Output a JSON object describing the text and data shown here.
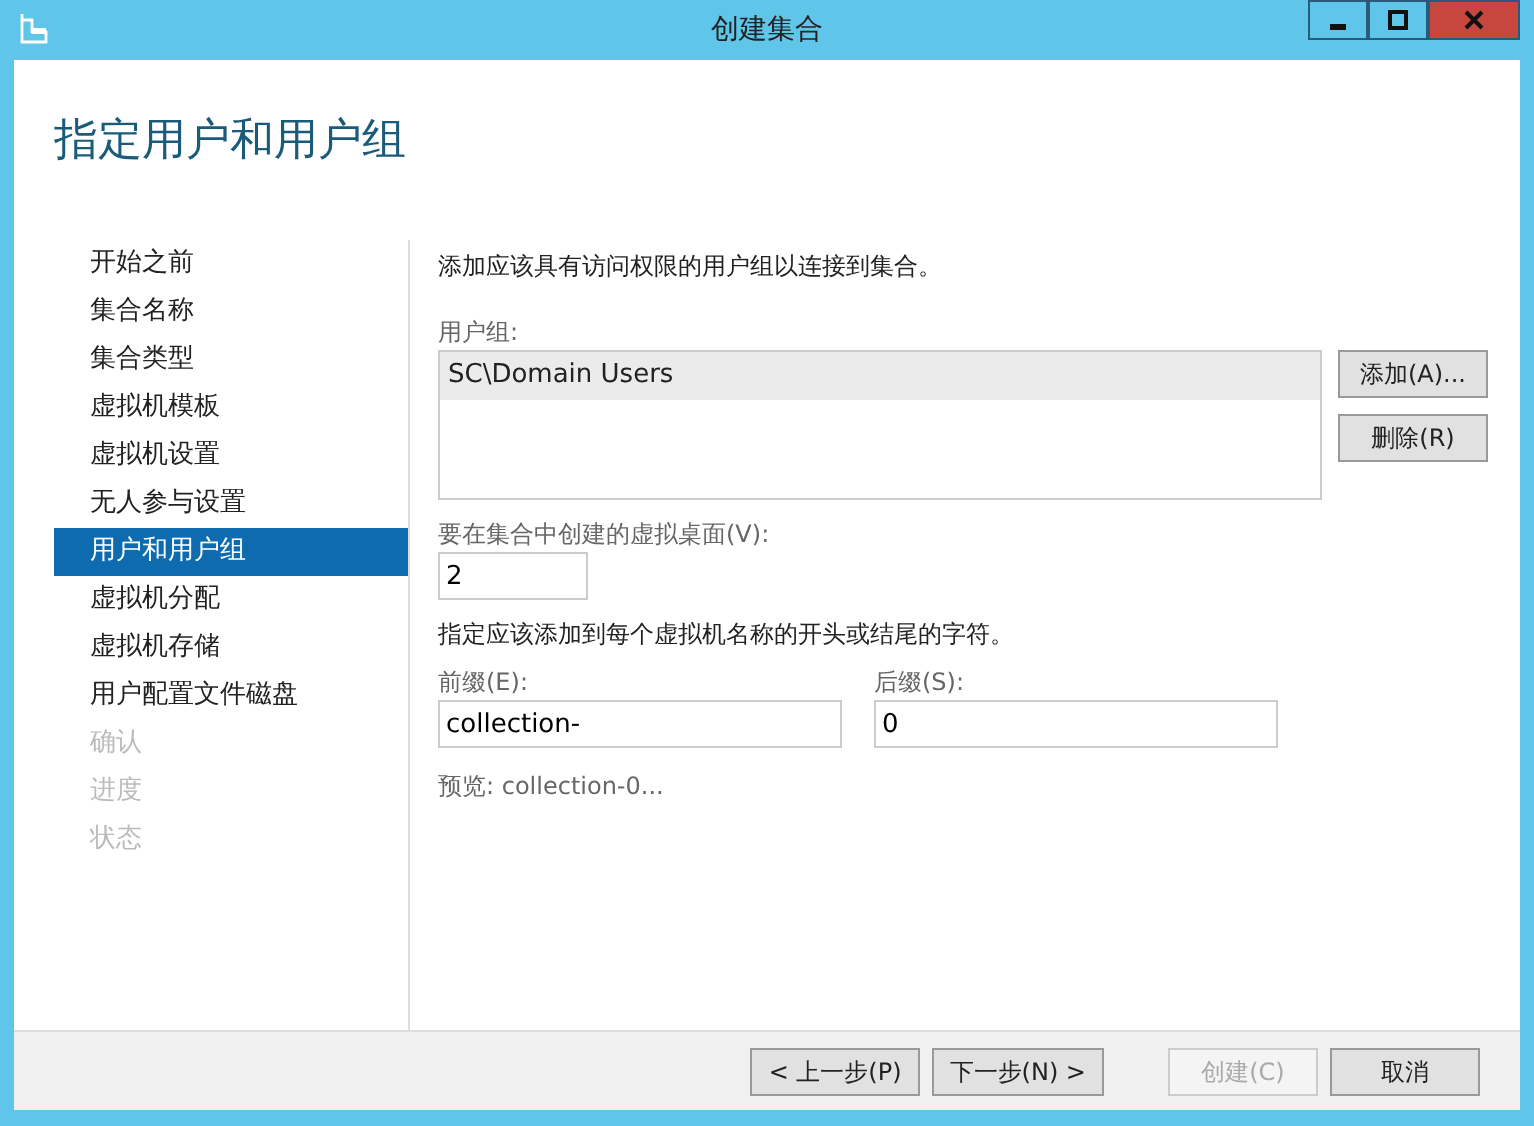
{
  "window": {
    "title": "创建集合"
  },
  "heading": "指定用户和用户组",
  "steps": [
    {
      "label": "开始之前",
      "selected": false,
      "disabled": false
    },
    {
      "label": "集合名称",
      "selected": false,
      "disabled": false
    },
    {
      "label": "集合类型",
      "selected": false,
      "disabled": false
    },
    {
      "label": "虚拟机模板",
      "selected": false,
      "disabled": false
    },
    {
      "label": "虚拟机设置",
      "selected": false,
      "disabled": false
    },
    {
      "label": "无人参与设置",
      "selected": false,
      "disabled": false
    },
    {
      "label": "用户和用户组",
      "selected": true,
      "disabled": false
    },
    {
      "label": "虚拟机分配",
      "selected": false,
      "disabled": false
    },
    {
      "label": "虚拟机存储",
      "selected": false,
      "disabled": false
    },
    {
      "label": "用户配置文件磁盘",
      "selected": false,
      "disabled": false
    },
    {
      "label": "确认",
      "selected": false,
      "disabled": true
    },
    {
      "label": "进度",
      "selected": false,
      "disabled": true
    },
    {
      "label": "状态",
      "selected": false,
      "disabled": true
    }
  ],
  "intro": "添加应该具有访问权限的用户组以连接到集合。",
  "user_groups": {
    "label": "用户组:",
    "items": [
      {
        "text": "SC\\Domain Users",
        "selected": true
      }
    ],
    "buttons": [
      "添加(A)...",
      "删除(R)"
    ]
  },
  "desktops": {
    "label": "要在集合中创建的虚拟桌面(V):",
    "value": "2"
  },
  "naming_hint": "指定应该添加到每个虚拟机名称的开头或结尾的字符。",
  "prefix": {
    "label": "前缀(E):",
    "value": "collection-"
  },
  "suffix": {
    "label": "后缀(S):",
    "value": "0"
  },
  "preview": "预览: collection-0...",
  "footer_buttons": [
    {
      "label": "< 上一步(P)",
      "disabled": false
    },
    {
      "label": "下一步(N) >",
      "disabled": false
    },
    {
      "label": "创建(C)",
      "disabled": true
    },
    {
      "label": "取消",
      "disabled": false
    }
  ]
}
